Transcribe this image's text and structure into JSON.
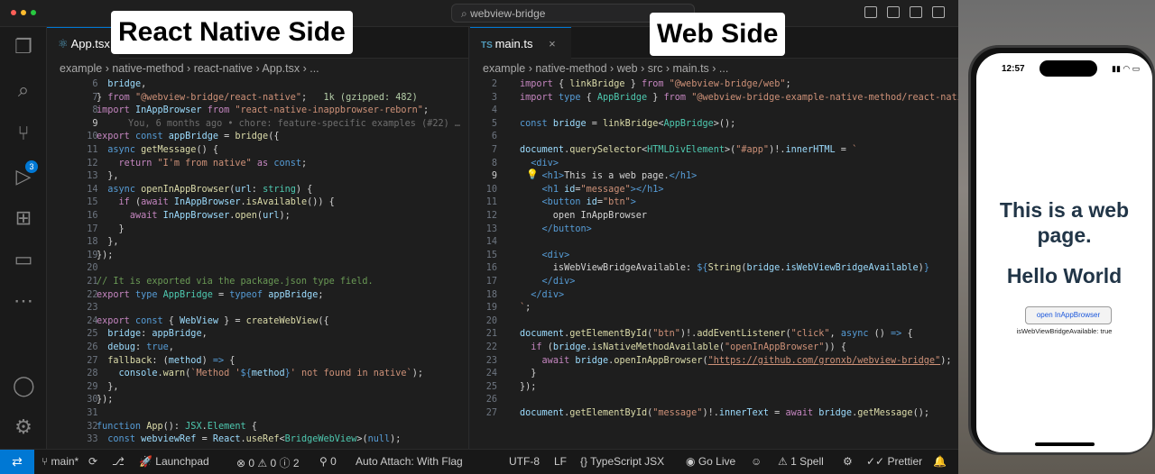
{
  "window": {
    "command_center": "webview-bridge"
  },
  "overlays": {
    "left": "React Native Side",
    "right": "Web Side"
  },
  "left_editor": {
    "tab": "App.tsx",
    "breadcrumb": [
      "example",
      "native-method",
      "react-native",
      "App.tsx",
      "..."
    ],
    "blame": "You, 6 months ago • chore: feature-specific examples (#22) …"
  },
  "right_editor": {
    "tab": "main.ts",
    "breadcrumb": [
      "example",
      "native-method",
      "web",
      "src",
      "main.ts",
      "..."
    ]
  },
  "activity": {
    "scm_badge": "3"
  },
  "status": {
    "branch": "main*",
    "launchpad": "Launchpad",
    "errors": "0",
    "warnings": "0",
    "info": "2",
    "ports": "0",
    "attach": "Auto Attach: With Flag",
    "encoding": "UTF-8",
    "eol": "LF",
    "language": "TypeScript JSX",
    "golive": "Go Live",
    "spell": "1 Spell",
    "prettier": "Prettier"
  },
  "phone": {
    "time": "12:57",
    "heading": "This is a web page.",
    "message": "Hello World",
    "button": "open InAppBrowser",
    "available": "isWebViewBridgeAvailable: true"
  },
  "colors": {
    "accent": "#0078d4",
    "editor_bg": "#1e1e1e"
  }
}
